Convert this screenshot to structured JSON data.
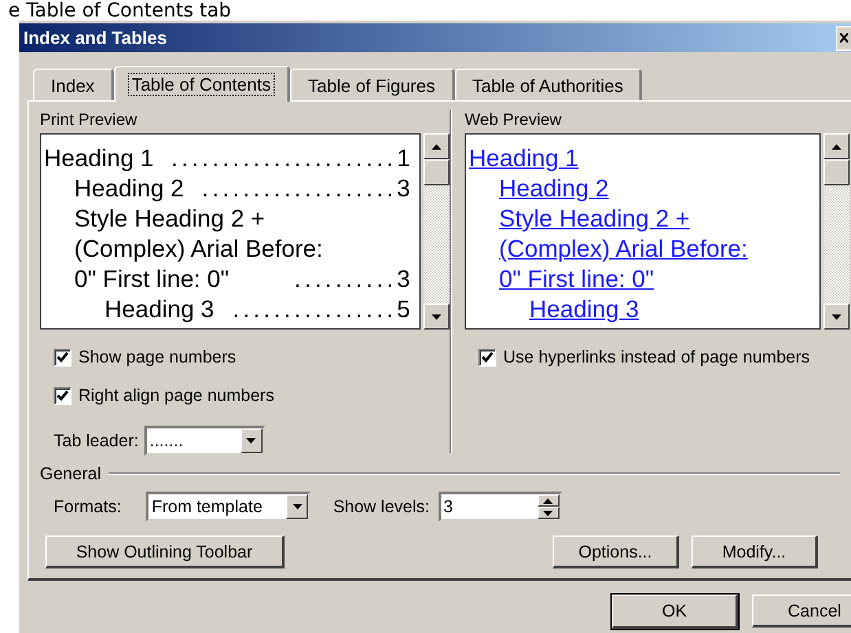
{
  "caption": "e Table of Contents tab",
  "window": {
    "title": "Index and Tables"
  },
  "tabs": [
    {
      "label": "Index",
      "selected": false
    },
    {
      "label": "Table of Contents",
      "selected": true
    },
    {
      "label": "Table of Figures",
      "selected": false
    },
    {
      "label": "Table of Authorities",
      "selected": false
    }
  ],
  "print_preview": {
    "label": "Print Preview",
    "entries": [
      {
        "lines": [
          "Heading 1"
        ],
        "leader": "......................",
        "page": "1",
        "children": [
          {
            "lines": [
              "Heading 2"
            ],
            "leader": "...................",
            "page": "3"
          },
          {
            "lines": [
              "Style Heading 2 +",
              "(Complex) Arial Before:",
              "0\" First line:  0\""
            ],
            "leader": "..........",
            "page": "3",
            "children": [
              {
                "lines": [
                  "Heading 3"
                ],
                "leader": "................",
                "page": "5"
              }
            ]
          }
        ]
      }
    ]
  },
  "web_preview": {
    "label": "Web Preview",
    "entries": [
      {
        "lines": [
          "Heading 1"
        ],
        "children": [
          {
            "lines": [
              "Heading 2"
            ]
          },
          {
            "lines": [
              "Style Heading 2 +",
              "(Complex) Arial Before:",
              "0\" First line:  0\""
            ],
            "children": [
              {
                "lines": [
                  "Heading 3"
                ]
              }
            ]
          }
        ]
      }
    ]
  },
  "print_options": [
    {
      "label": "Show page numbers",
      "checked": true
    },
    {
      "label": "Right align page numbers",
      "checked": true
    }
  ],
  "tab_leader": {
    "label": "Tab leader:",
    "value": "......."
  },
  "web_options": [
    {
      "label": "Use hyperlinks instead of page numbers",
      "checked": true
    }
  ],
  "general": {
    "label": "General",
    "formats_label": "Formats:",
    "formats_value": "From template",
    "levels_label": "Show levels:",
    "levels_value": "3"
  },
  "panel_buttons": [
    {
      "label": "Show Outlining Toolbar"
    },
    {
      "label": "Options..."
    },
    {
      "label": "Modify..."
    }
  ],
  "dialog_buttons": [
    {
      "label": "OK",
      "default": true
    },
    {
      "label": "Cancel",
      "default": false
    }
  ]
}
